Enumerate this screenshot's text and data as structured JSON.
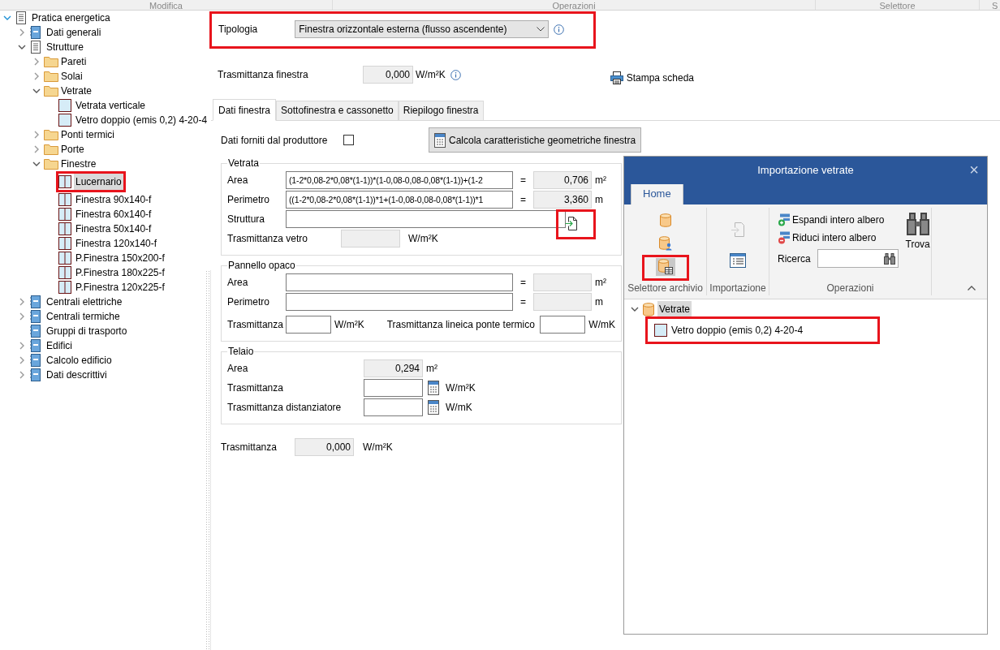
{
  "ribbon_groups": [
    {
      "label": "Modifica"
    },
    {
      "label": "Operazioni"
    },
    {
      "label": "Selettore"
    },
    {
      "label": "S"
    }
  ],
  "tree": [
    {
      "label": "Pratica energetica",
      "kind": "doc",
      "expanded": true,
      "selected": false,
      "children": [
        {
          "label": "Dati generali",
          "kind": "module",
          "expanded": false,
          "selected": false
        },
        {
          "label": "Strutture",
          "kind": "doc",
          "expanded": true,
          "selected": false,
          "children": [
            {
              "label": "Pareti",
              "kind": "folder",
              "expanded": false,
              "selected": false
            },
            {
              "label": "Solai",
              "kind": "folder",
              "expanded": false,
              "selected": false
            },
            {
              "label": "Vetrate",
              "kind": "folder",
              "expanded": true,
              "selected": false,
              "children": [
                {
                  "label": "Vetrata verticale",
                  "kind": "glass",
                  "selected": false
                },
                {
                  "label": "Vetro doppio (emis 0,2) 4-20-4",
                  "kind": "glass",
                  "selected": false
                }
              ]
            },
            {
              "label": "Ponti termici",
              "kind": "folder",
              "expanded": false,
              "selected": false
            },
            {
              "label": "Porte",
              "kind": "folder",
              "expanded": false,
              "selected": false
            },
            {
              "label": "Finestre",
              "kind": "folder",
              "expanded": true,
              "selected": false,
              "children": [
                {
                  "label": "Lucernario",
                  "kind": "window",
                  "selected": true,
                  "highlighted": true
                },
                {
                  "label": "Finestra 90x140-f",
                  "kind": "window",
                  "selected": false
                },
                {
                  "label": "Finestra 60x140-f",
                  "kind": "window",
                  "selected": false
                },
                {
                  "label": "Finestra 50x140-f",
                  "kind": "window",
                  "selected": false
                },
                {
                  "label": "Finestra 120x140-f",
                  "kind": "window",
                  "selected": false
                },
                {
                  "label": "P.Finestra 150x200-f",
                  "kind": "window",
                  "selected": false
                },
                {
                  "label": "P.Finestra 180x225-f",
                  "kind": "window",
                  "selected": false
                },
                {
                  "label": "P.Finestra 120x225-f",
                  "kind": "window",
                  "selected": false
                }
              ]
            }
          ]
        },
        {
          "label": "Centrali elettriche",
          "kind": "module",
          "expanded": false,
          "selected": false
        },
        {
          "label": "Centrali termiche",
          "kind": "module",
          "expanded": false,
          "selected": false
        },
        {
          "label": "Gruppi di trasporto",
          "kind": "module",
          "selected": false
        },
        {
          "label": "Edifici",
          "kind": "module",
          "expanded": false,
          "selected": false
        },
        {
          "label": "Calcolo edificio",
          "kind": "module",
          "expanded": false,
          "selected": false
        },
        {
          "label": "Dati descrittivi",
          "kind": "module",
          "expanded": false,
          "selected": false
        }
      ]
    }
  ],
  "tipologia": {
    "label": "Tipologia",
    "value": "Finestra orizzontale esterna (flusso ascendente)",
    "highlighted": true
  },
  "trasmittanza_finestra": {
    "label": "Trasmittanza finestra",
    "value": "0,000",
    "unit": "W/m²K"
  },
  "print_button": {
    "label": "Stampa scheda"
  },
  "tabs": [
    {
      "label": "Dati finestra",
      "selected": true
    },
    {
      "label": "Sottofinestra e cassonetto",
      "selected": false
    },
    {
      "label": "Riepilogo finestra",
      "selected": false
    }
  ],
  "producer_data": {
    "label": "Dati forniti dal produttore",
    "checked": false
  },
  "calc_button": {
    "label": "Calcola caratteristiche geometriche finestra"
  },
  "vetrata": {
    "title": "Vetrata",
    "formulas": [
      {
        "label": "Area",
        "formula": "(1-2*0,08-2*0,08*(1-1))*(1-0,08-0,08-0,08*(1-1))+(1-2",
        "equals": "=",
        "result": "0,706",
        "unit": "m²"
      },
      {
        "label": "Perimetro",
        "formula": "((1-2*0,08-2*0,08*(1-1))*1+(1-0,08-0,08-0,08*(1-1))*1",
        "equals": "=",
        "result": "3,360",
        "unit": "m"
      }
    ],
    "struttura": {
      "label": "Struttura",
      "highlighted": true
    },
    "trasmittanza_vetro": {
      "label": "Trasmittanza vetro",
      "unit": "W/m²K"
    }
  },
  "pannello_opaco": {
    "title": "Pannello opaco",
    "formulas": [
      {
        "label": "Area",
        "equals": "=",
        "unit": "m²"
      },
      {
        "label": "Perimetro",
        "equals": "=",
        "unit": "m"
      }
    ],
    "trasmittanza": {
      "label": "Trasmittanza",
      "unit": "W/m²K"
    },
    "ponte_termico": {
      "label": "Trasmittanza lineica ponte termico",
      "unit": "W/mK"
    }
  },
  "telaio": {
    "title": "Telaio",
    "area": {
      "label": "Area",
      "value": "0,294",
      "unit": "m²"
    },
    "rows": [
      {
        "label": "Trasmittanza",
        "unit": "W/m²K"
      },
      {
        "label": "Trasmittanza distanziatore",
        "unit": "W/mK"
      }
    ]
  },
  "trasmittanza_totale": {
    "label": "Trasmittanza",
    "value": "0,000",
    "unit": "W/m²K"
  },
  "dialog": {
    "title": "Importazione vetrate",
    "close": "×",
    "tabs": [
      {
        "label": "Home",
        "selected": true
      }
    ],
    "archive_group": {
      "label": "Selettore archivio",
      "buttons": [
        {
          "kind": "database",
          "selected": false
        },
        {
          "kind": "database-user",
          "selected": false
        },
        {
          "kind": "database-table",
          "selected": true,
          "highlighted": true
        }
      ]
    },
    "import_group": {
      "label": "Importazione",
      "buttons": [
        {
          "kind": "import",
          "disabled": true
        },
        {
          "kind": "list",
          "disabled": false
        }
      ]
    },
    "operations_group": {
      "label": "Operazioni",
      "expand": "Espandi intero albero",
      "collapse": "Riduci intero albero",
      "search_label": "Ricerca",
      "find": "Trova"
    },
    "tree": [
      {
        "label": "Vetrate",
        "kind": "database",
        "expanded": true,
        "selected": true,
        "children": [
          {
            "label": "Vetro doppio (emis 0,2) 4-20-4",
            "kind": "glass",
            "selected": false,
            "highlighted": true
          }
        ]
      }
    ]
  }
}
